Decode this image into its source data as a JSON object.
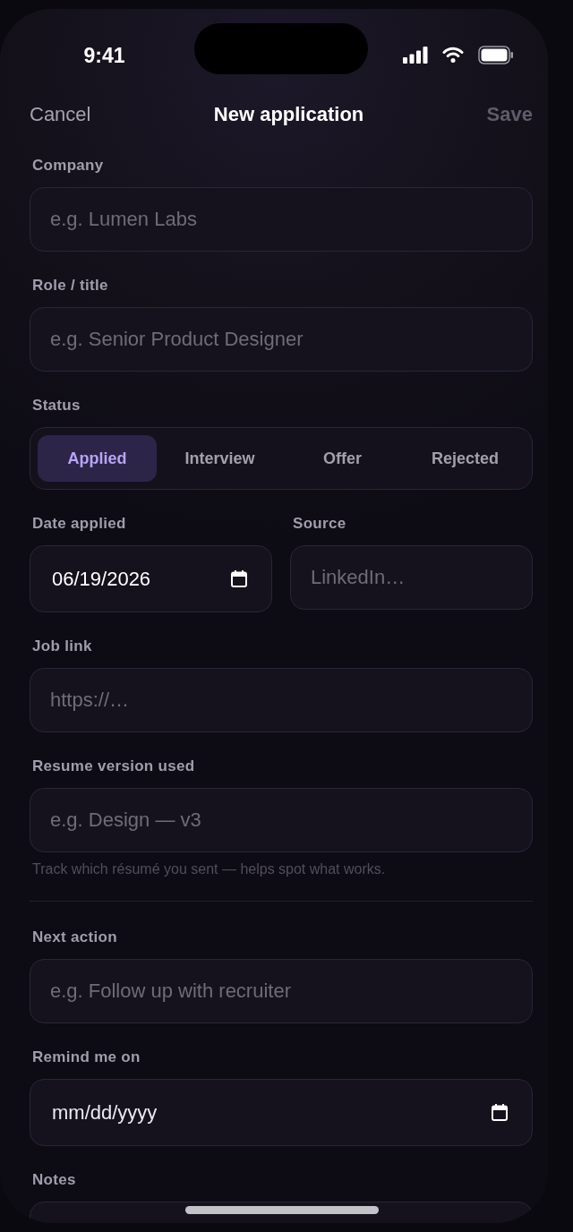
{
  "status_bar": {
    "time": "9:41"
  },
  "nav": {
    "cancel": "Cancel",
    "title": "New application",
    "save": {
      "label": "Save",
      "disabled": true
    }
  },
  "form": [
    {
      "kind": "text",
      "label": "Company",
      "placeholder": "e.g. Lumen Labs"
    },
    {
      "kind": "text",
      "label": "Role / title",
      "placeholder": "e.g. Senior Product Designer"
    },
    {
      "kind": "segmented",
      "label": "Status",
      "options": [
        {
          "label": "Applied",
          "selected": true
        },
        {
          "label": "Interview",
          "selected": false
        },
        {
          "label": "Offer",
          "selected": false
        },
        {
          "label": "Rejected",
          "selected": false
        }
      ]
    },
    {
      "kind": "pair",
      "fields": [
        {
          "kind": "date",
          "label": "Date applied",
          "value": "06/19/2026"
        },
        {
          "kind": "text",
          "label": "Source",
          "placeholder": "LinkedIn…"
        }
      ]
    },
    {
      "kind": "text",
      "label": "Job link",
      "placeholder": "https://…"
    },
    {
      "kind": "text",
      "label": "Resume version used",
      "placeholder": "e.g. Design — v3",
      "hint": "Track which résumé you sent — helps spot what works."
    },
    {
      "kind": "divider"
    },
    {
      "kind": "text",
      "label": "Next action",
      "placeholder": "e.g. Follow up with recruiter"
    },
    {
      "kind": "date",
      "label": "Remind me on",
      "placeholder": "mm/dd/yyyy"
    },
    {
      "kind": "textarea",
      "label": "Notes"
    }
  ]
}
